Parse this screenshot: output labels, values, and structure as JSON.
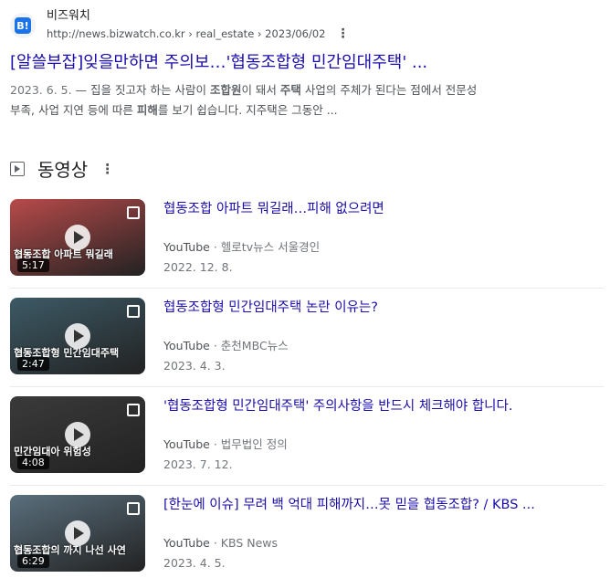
{
  "result": {
    "favicon_text": "B!",
    "site_name": "비즈워치",
    "url": "http://news.bizwatch.co.kr",
    "breadcrumb": "› real_estate › 2023/06/02",
    "title": "[알쓸부잡]잊을만하면 주의보…'협동조합형 민간임대주택' ...",
    "snippet_date": "2023. 6. 5.",
    "snippet_parts": [
      " — 집을 짓고자 하는 사람이 ",
      "조합원",
      "이 돼서 ",
      "주택",
      " 사업의 주체가 된다는 점에서 전문성"
    ],
    "snippet_line2_parts": [
      "부족, 사업 지연 등에 따른 ",
      "피해",
      "를 보기 쉽습니다. 지주택은 그동안 ..."
    ]
  },
  "videos_section": {
    "title": "동영상"
  },
  "videos": [
    {
      "title": "협동조합 아파트 뭐길래…피해 없으려면",
      "platform": "YouTube",
      "separator": "·",
      "channel": "헬로tv뉴스 서울경인",
      "date": "2022. 12. 8.",
      "duration": "5:17",
      "thumb_text": "협동조합 아파트 뭐길래",
      "thumb_bg": "#b84a4a"
    },
    {
      "title": "협동조합형 민간임대주택 논란 이유는?",
      "platform": "YouTube",
      "separator": "·",
      "channel": "춘천MBC뉴스",
      "date": "2023. 4. 3.",
      "duration": "2:47",
      "thumb_text": "협동조합형 민간임대주택",
      "thumb_bg": "#3d5a66"
    },
    {
      "title": "'협동조합형 민간임대주택' 주의사항을 반드시 체크해야 합니다.",
      "platform": "YouTube",
      "separator": "·",
      "channel": "법무법인 정의",
      "date": "2023. 7. 12.",
      "duration": "4:08",
      "thumb_text": "민간임대아  위험성",
      "thumb_bg": "#3a3a3a"
    },
    {
      "title": "[한눈에 이슈] 무려 백 억대 피해까지…못 믿을 협동조합? / KBS ...",
      "platform": "YouTube",
      "separator": "·",
      "channel": "KBS News",
      "date": "2023. 4. 5.",
      "duration": "6:29",
      "thumb_text": "협동조합의  까지 나선 사연",
      "thumb_bg": "#5a6f7d"
    }
  ]
}
